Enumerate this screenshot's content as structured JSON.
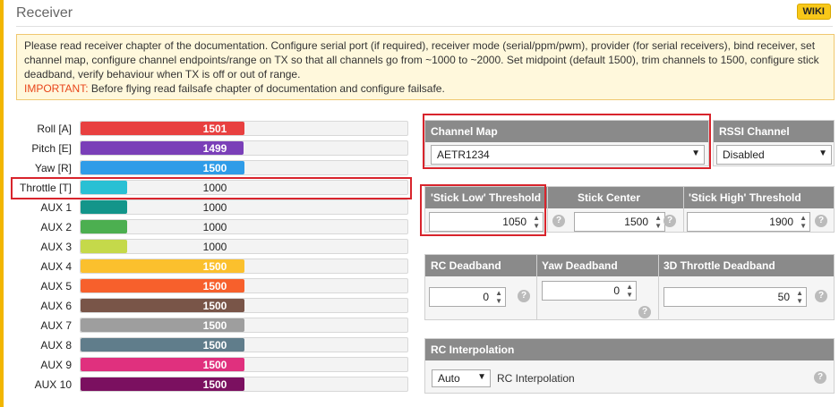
{
  "header": {
    "title": "Receiver",
    "wiki_label": "WIKI"
  },
  "note": {
    "text": "Please read receiver chapter of the documentation. Configure serial port (if required), receiver mode (serial/ppm/pwm), provider (for serial receivers), bind receiver, set channel map, configure channel endpoints/range on TX so that all channels go from ~1000 to ~2000. Set midpoint (default 1500), trim channels to 1500, configure stick deadband, verify behaviour when TX is off or out of range.",
    "important_label": "IMPORTANT:",
    "important_text": " Before flying read failsafe chapter of documentation and configure failsafe."
  },
  "channels": [
    {
      "label": "Roll [A]",
      "value": "1501",
      "level": 0.501,
      "color": "#e84040"
    },
    {
      "label": "Pitch [E]",
      "value": "1499",
      "level": 0.499,
      "color": "#7a3fb8"
    },
    {
      "label": "Yaw [R]",
      "value": "1500",
      "level": 0.5,
      "color": "#2f9ce8"
    },
    {
      "label": "Throttle [T]",
      "value": "1000",
      "level": 0.143,
      "color": "#29c0d4"
    },
    {
      "label": "AUX 1",
      "value": "1000",
      "level": 0.143,
      "color": "#13958a"
    },
    {
      "label": "AUX 2",
      "value": "1000",
      "level": 0.143,
      "color": "#4caf50"
    },
    {
      "label": "AUX 3",
      "value": "1000",
      "level": 0.143,
      "color": "#c5d94a"
    },
    {
      "label": "AUX 4",
      "value": "1500",
      "level": 0.5,
      "color": "#fbc02d"
    },
    {
      "label": "AUX 5",
      "value": "1500",
      "level": 0.5,
      "color": "#f7602c"
    },
    {
      "label": "AUX 6",
      "value": "1500",
      "level": 0.5,
      "color": "#795548"
    },
    {
      "label": "AUX 7",
      "value": "1500",
      "level": 0.5,
      "color": "#9e9e9e"
    },
    {
      "label": "AUX 8",
      "value": "1500",
      "level": 0.5,
      "color": "#607d8b"
    },
    {
      "label": "AUX 9",
      "value": "1500",
      "level": 0.5,
      "color": "#e0307e"
    },
    {
      "label": "AUX 10",
      "value": "1500",
      "level": 0.5,
      "color": "#7b1060"
    }
  ],
  "channel_map": {
    "title": "Channel Map",
    "value": "AETR1234"
  },
  "rssi": {
    "title": "RSSI Channel",
    "value": "Disabled"
  },
  "stick": {
    "low_title": "'Stick Low' Threshold",
    "low_value": "1050",
    "center_title": "Stick Center",
    "center_value": "1500",
    "high_title": "'Stick High' Threshold",
    "high_value": "1900"
  },
  "deadband": {
    "rc_title": "RC Deadband",
    "rc_value": "0",
    "yaw_title": "Yaw Deadband",
    "yaw_value": "0",
    "throttle3d_title": "3D Throttle Deadband",
    "throttle3d_value": "50"
  },
  "interpolation": {
    "title": "RC Interpolation",
    "value": "Auto",
    "label": "RC Interpolation"
  },
  "help_glyph": "?"
}
